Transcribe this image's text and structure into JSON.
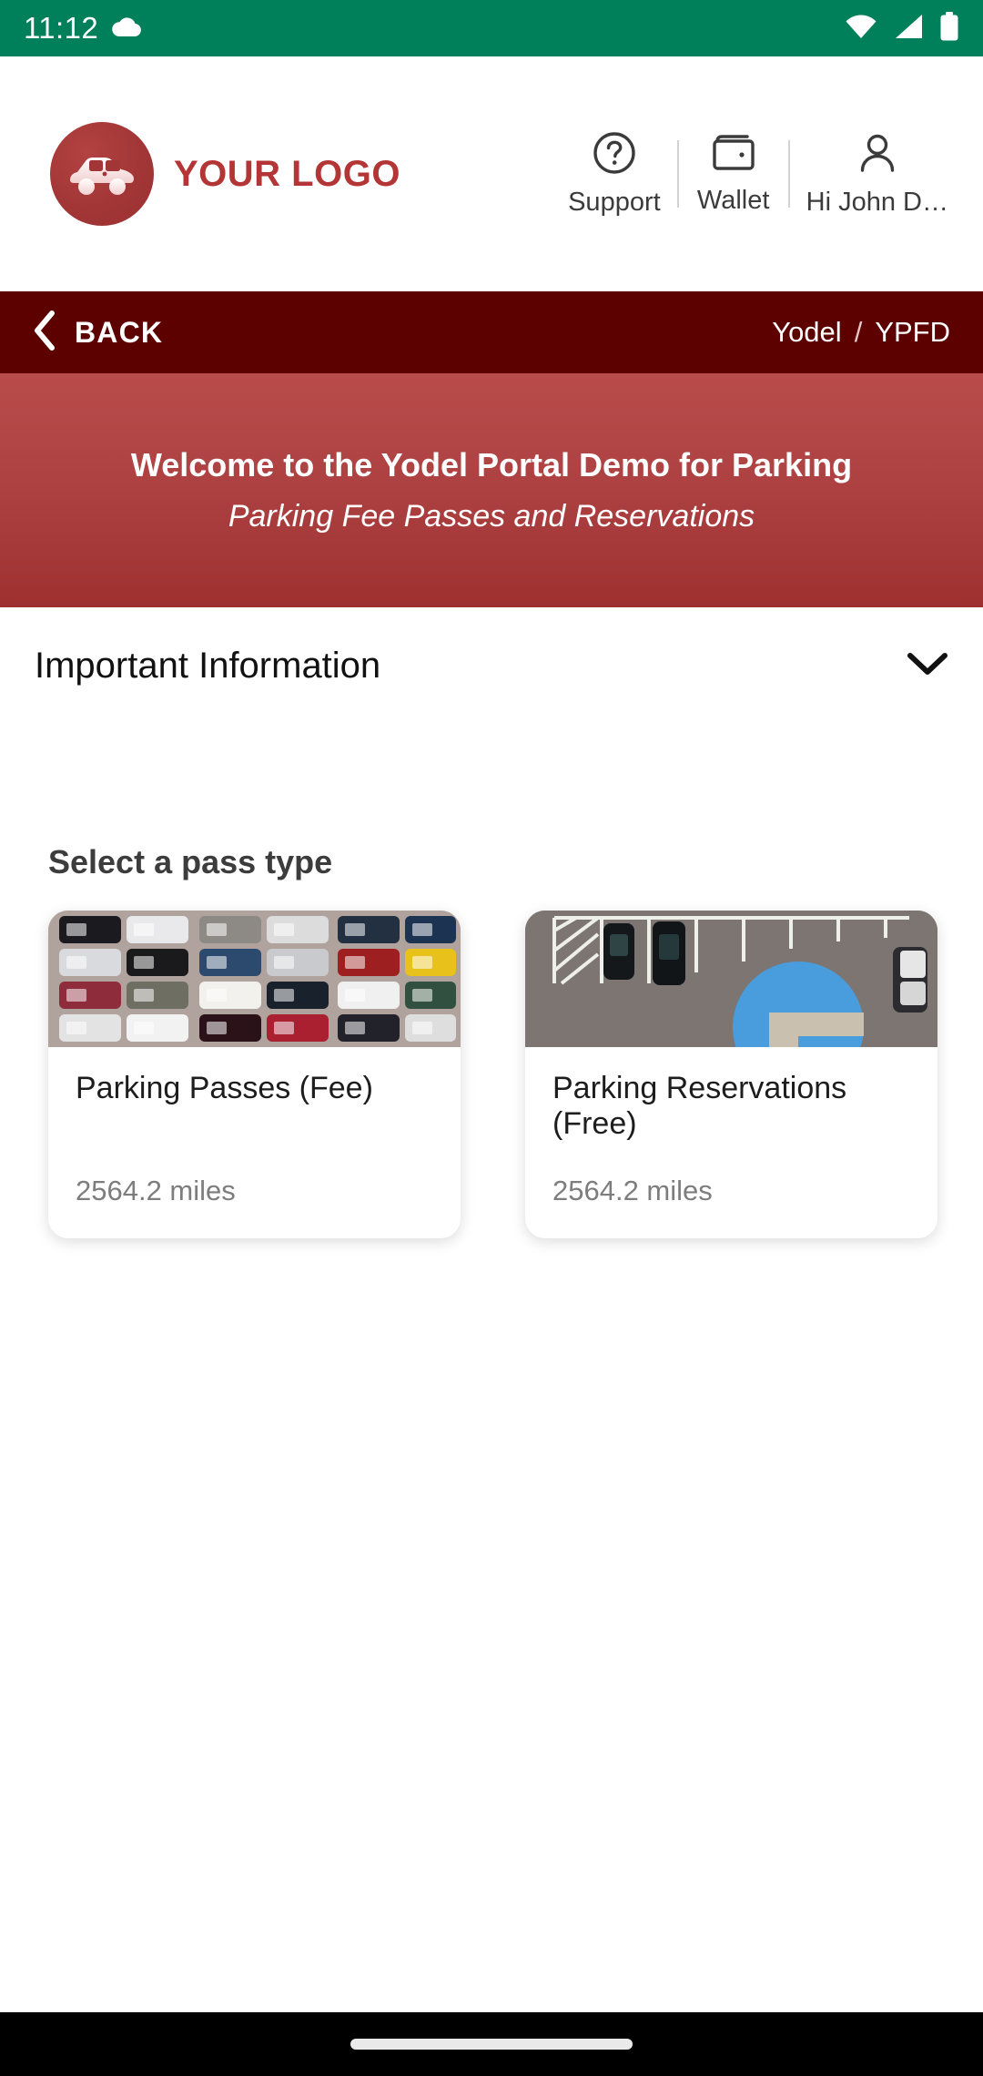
{
  "status_bar": {
    "time": "11:12",
    "icons": [
      "cloud-icon",
      "wifi-icon",
      "cellular-signal-icon",
      "battery-icon"
    ],
    "background_color": "#00805A"
  },
  "header": {
    "logo_icon": "car-logo-icon",
    "brand_text": "YOUR LOGO",
    "brand_color": "#b43535",
    "nav": [
      {
        "icon": "question-circle-icon",
        "label": "Support"
      },
      {
        "icon": "wallet-icon",
        "label": "Wallet"
      },
      {
        "icon": "user-icon",
        "label": "Hi John D…"
      }
    ]
  },
  "back_bar": {
    "back_label": "BACK",
    "back_icon": "chevron-left-icon",
    "breadcrumb": {
      "root": "Yodel",
      "separator": "/",
      "current": "YPFD"
    },
    "background_color": "#5c0000"
  },
  "banner": {
    "title": "Welcome to the Yodel Portal Demo for Parking",
    "subtitle": "Parking Fee Passes and Reservations",
    "background_color": "#ae4242"
  },
  "accordion": {
    "title": "Important Information",
    "chevron_icon": "chevron-down-icon",
    "expanded": false
  },
  "main": {
    "section_title": "Select a pass type",
    "cards": [
      {
        "image_name": "aerial-parking-lot-full-photo",
        "title": "Parking Passes (Fee)",
        "distance": "2564.2 miles"
      },
      {
        "image_name": "aerial-parking-lot-empty-photo",
        "title": "Parking Reservations (Free)",
        "distance": "2564.2 miles"
      }
    ]
  },
  "bottom_nav": {
    "home_indicator": "home-indicator-pill",
    "background_color": "#000000"
  }
}
